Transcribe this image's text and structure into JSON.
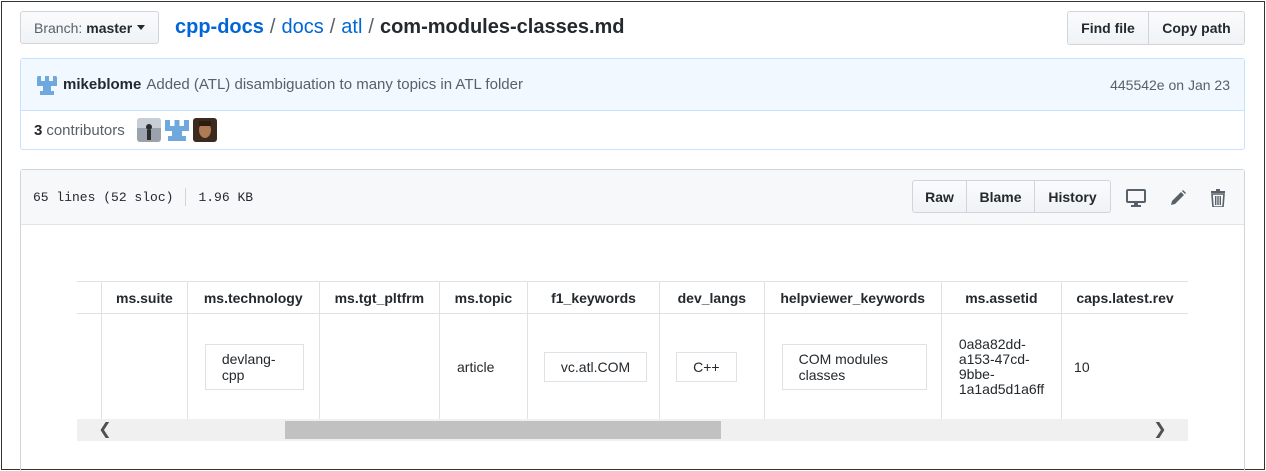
{
  "branch": {
    "prefix": "Branch:",
    "name": "master"
  },
  "breadcrumb": {
    "repo": "cpp-docs",
    "dir1": "docs",
    "dir2": "atl",
    "sep": "/",
    "file": "com-modules-classes.md"
  },
  "top_buttons": {
    "find_file": "Find file",
    "copy_path": "Copy path"
  },
  "commit": {
    "author": "mikeblome",
    "message": "Added (ATL) disambiguation to many topics in ATL folder",
    "sha": "445542e",
    "date": "on Jan 23"
  },
  "contributors": {
    "count": "3",
    "label": "contributors"
  },
  "file_info": {
    "lines": "65 lines (52 sloc)",
    "size": "1.96 KB"
  },
  "file_buttons": {
    "raw": "Raw",
    "blame": "Blame",
    "history": "History"
  },
  "file_icons": [
    "desktop-icon",
    "pencil-icon",
    "trash-icon"
  ],
  "table": {
    "headers": [
      "ms.suite",
      "ms.technology",
      "ms.tgt_pltfrm",
      "ms.topic",
      "f1_keywords",
      "dev_langs",
      "helpviewer_keywords",
      "ms.assetid",
      "caps.latest.rev"
    ],
    "row": {
      "technology": "devlang-\ncpp",
      "topic": "article",
      "f1": "vc.atl.COM",
      "dev_langs": "C++",
      "helpviewer": "COM modules\nclasses",
      "assetid": "0a8a82dd-\na153-47cd-\n9bbe-\n1a1ad5d1a6ff",
      "rev": "10"
    }
  },
  "scrollbar": {
    "left_arrow": "❮",
    "right_arrow": "❯",
    "thumb_fraction": 0.39
  },
  "colors": {
    "link": "#0366d6",
    "commit_bg": "#f1f8ff",
    "header_bg": "#f6f8fa"
  }
}
